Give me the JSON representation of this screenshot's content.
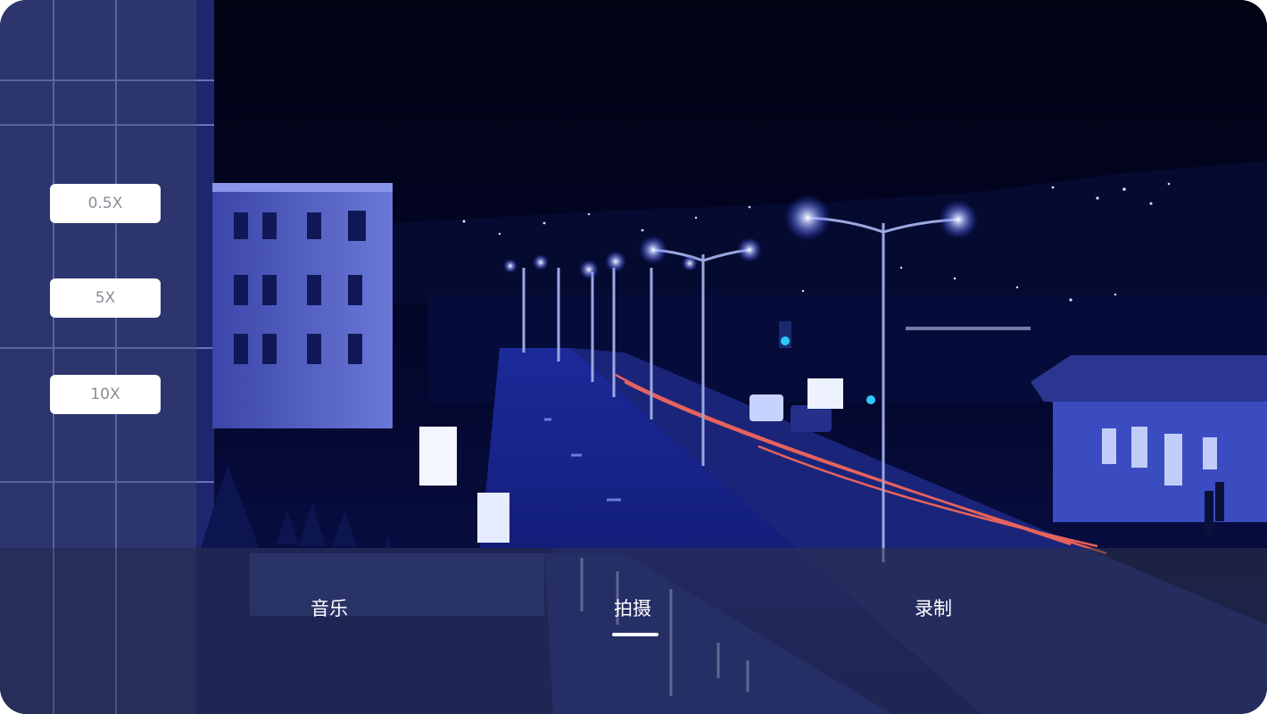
{
  "zoom": {
    "options": [
      "0.5X",
      "5X",
      "10X"
    ]
  },
  "modes": {
    "items": [
      "音乐",
      "拍摄",
      "录制"
    ],
    "active": "拍摄"
  },
  "colors": {
    "sky": "#02031a",
    "street_light": "#ffffff",
    "light_trail": "#ff5a4a",
    "signal": "#2ec8ff",
    "overlay": "#464e6e"
  }
}
